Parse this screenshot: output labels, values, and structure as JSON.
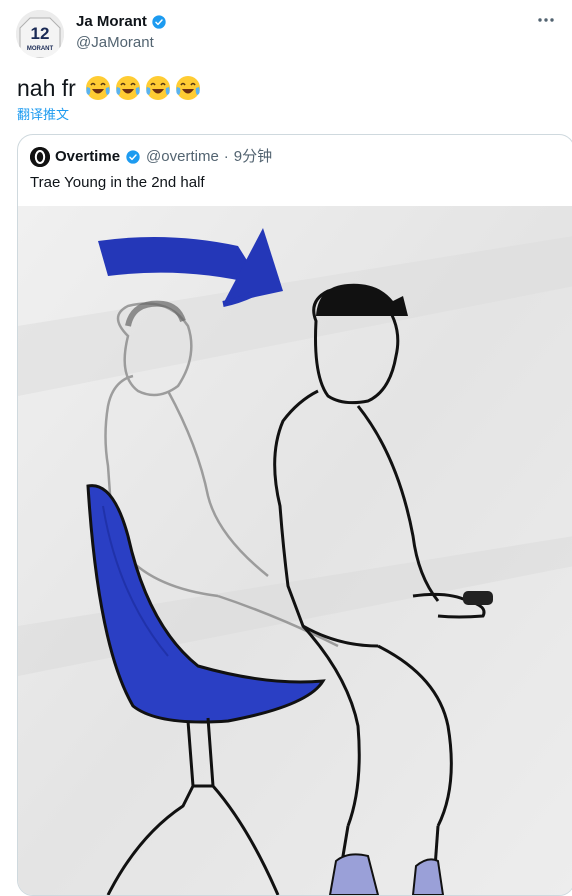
{
  "tweet": {
    "author": {
      "name": "Ja Morant",
      "handle": "@JaMorant",
      "jersey_number": "12",
      "jersey_name": "MORANT"
    },
    "text": "nah fr",
    "emojis": [
      "😂",
      "😂",
      "😂",
      "😂"
    ],
    "translate_label": "翻译推文",
    "icons": {
      "verified": "verified-badge-icon",
      "more": "more-options-icon"
    },
    "colors": {
      "accent": "#1d9bf0",
      "secondary_text": "#536471",
      "border": "#cfd9de",
      "chair_blue": "#2a3fc4"
    }
  },
  "quoted": {
    "name": "Overtime",
    "handle": "@overtime",
    "separator": "·",
    "time": "9分钟",
    "text": "Trae Young in the 2nd half"
  }
}
